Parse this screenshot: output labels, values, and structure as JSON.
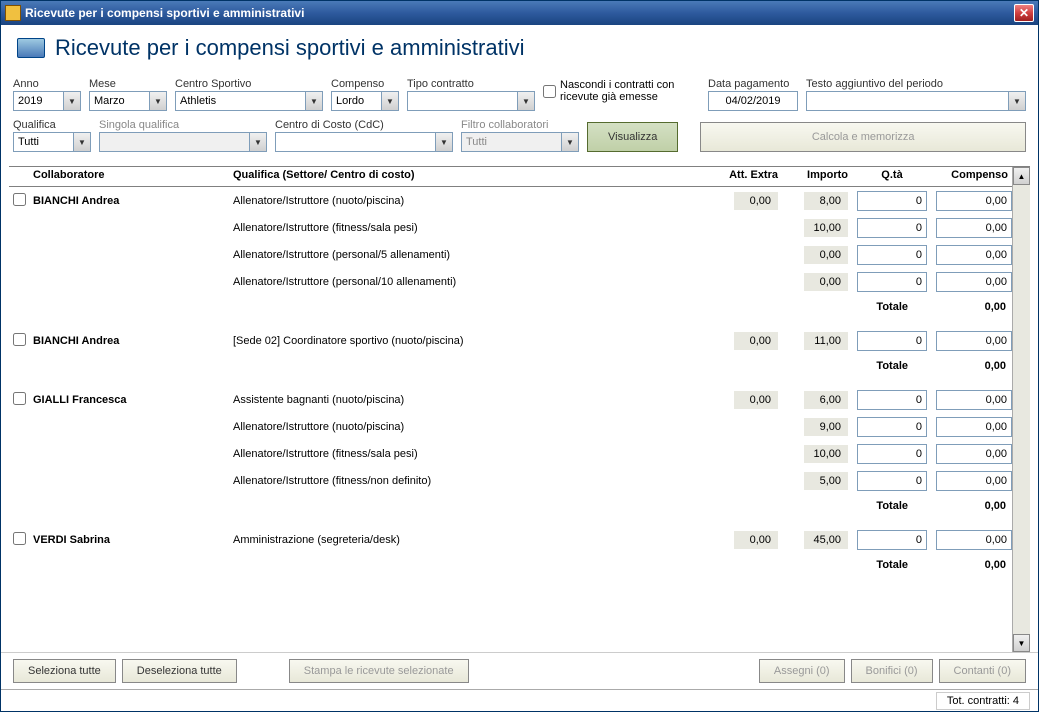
{
  "window": {
    "title": "Ricevute per i compensi sportivi e amministrativi"
  },
  "header": {
    "title": "Ricevute per i compensi sportivi e amministrativi"
  },
  "filters": {
    "anno": {
      "label": "Anno",
      "value": "2019"
    },
    "mese": {
      "label": "Mese",
      "value": "Marzo"
    },
    "centro": {
      "label": "Centro Sportivo",
      "value": "Athletis"
    },
    "compenso": {
      "label": "Compenso",
      "value": "Lordo"
    },
    "tipo": {
      "label": "Tipo contratto",
      "value": ""
    },
    "nascondi": {
      "label": "Nascondi i contratti con ricevute già emesse"
    },
    "data_pag": {
      "label": "Data pagamento",
      "value": "04/02/2019"
    },
    "testo_agg": {
      "label": "Testo aggiuntivo del periodo",
      "value": ""
    },
    "qualifica": {
      "label": "Qualifica",
      "value": "Tutti"
    },
    "singola": {
      "label": "Singola qualifica",
      "value": ""
    },
    "cdc": {
      "label": "Centro di Costo (CdC)",
      "value": ""
    },
    "filtro_collab": {
      "label": "Filtro collaboratori",
      "value": "Tutti"
    },
    "visualizza": "Visualizza",
    "calcola": "Calcola e memorizza"
  },
  "columns": {
    "collab": "Collaboratore",
    "qual": "Qualifica (Settore/ Centro di costo)",
    "extra": "Att. Extra",
    "importo": "Importo",
    "qta": "Q.tà",
    "compenso": "Compenso"
  },
  "groups": [
    {
      "name": "BIANCHI Andrea",
      "rows": [
        {
          "qual": "Allenatore/Istruttore (nuoto/piscina)",
          "extra": "0,00",
          "importo": "8,00",
          "qta": "0",
          "comp": "0,00"
        },
        {
          "qual": "Allenatore/Istruttore (fitness/sala pesi)",
          "extra": "",
          "importo": "10,00",
          "qta": "0",
          "comp": "0,00"
        },
        {
          "qual": "Allenatore/Istruttore (personal/5 allenamenti)",
          "extra": "",
          "importo": "0,00",
          "qta": "0",
          "comp": "0,00"
        },
        {
          "qual": "Allenatore/Istruttore (personal/10 allenamenti)",
          "extra": "",
          "importo": "0,00",
          "qta": "0",
          "comp": "0,00"
        }
      ],
      "total": "0,00"
    },
    {
      "name": "BIANCHI Andrea",
      "rows": [
        {
          "qual": "[Sede 02] Coordinatore sportivo (nuoto/piscina)",
          "extra": "0,00",
          "importo": "11,00",
          "qta": "0",
          "comp": "0,00"
        }
      ],
      "total": "0,00"
    },
    {
      "name": "GIALLI Francesca",
      "rows": [
        {
          "qual": "Assistente bagnanti (nuoto/piscina)",
          "extra": "0,00",
          "importo": "6,00",
          "qta": "0",
          "comp": "0,00"
        },
        {
          "qual": "Allenatore/Istruttore (nuoto/piscina)",
          "extra": "",
          "importo": "9,00",
          "qta": "0",
          "comp": "0,00"
        },
        {
          "qual": "Allenatore/Istruttore (fitness/sala pesi)",
          "extra": "",
          "importo": "10,00",
          "qta": "0",
          "comp": "0,00"
        },
        {
          "qual": "Allenatore/Istruttore (fitness/non definito)",
          "extra": "",
          "importo": "5,00",
          "qta": "0",
          "comp": "0,00"
        }
      ],
      "total": "0,00"
    },
    {
      "name": "VERDI Sabrina",
      "rows": [
        {
          "qual": "Amministrazione (segreteria/desk)",
          "extra": "0,00",
          "importo": "45,00",
          "qta": "0",
          "comp": "0,00"
        }
      ],
      "total": "0,00"
    }
  ],
  "totale_label": "Totale",
  "footer": {
    "sel_tutte": "Seleziona tutte",
    "desel_tutte": "Deseleziona tutte",
    "stampa": "Stampa le ricevute selezionate",
    "assegni": "Assegni (0)",
    "bonifici": "Bonifici (0)",
    "contanti": "Contanti (0)"
  },
  "status": {
    "tot_contratti": "Tot. contratti: 4"
  }
}
